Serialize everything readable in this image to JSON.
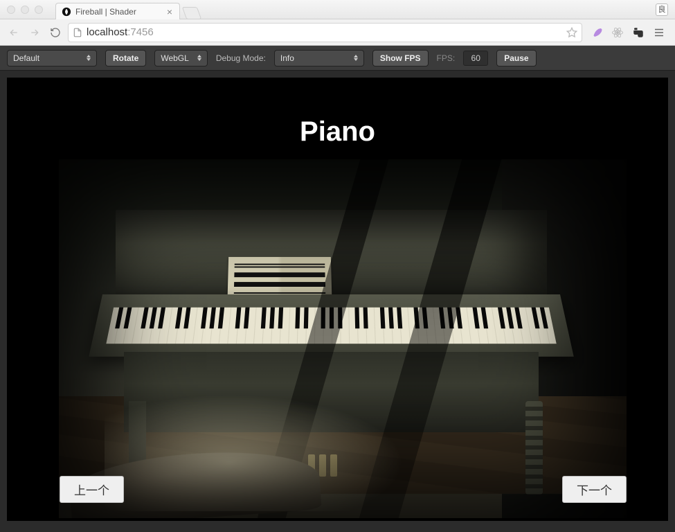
{
  "window": {
    "tab_title": "Fireball | Shader",
    "profile_badge": "良"
  },
  "browser": {
    "url_host": "localhost",
    "url_port": ":7456"
  },
  "toolbar": {
    "mode_select": "Default",
    "rotate_label": "Rotate",
    "renderer_select": "WebGL",
    "debug_label": "Debug Mode:",
    "debug_value": "Info",
    "showfps_label": "Show FPS",
    "fps_label": "FPS:",
    "fps_value": "60",
    "pause_label": "Pause"
  },
  "scene": {
    "title": "Piano",
    "prev_label": "上一个",
    "next_label": "下一个"
  }
}
